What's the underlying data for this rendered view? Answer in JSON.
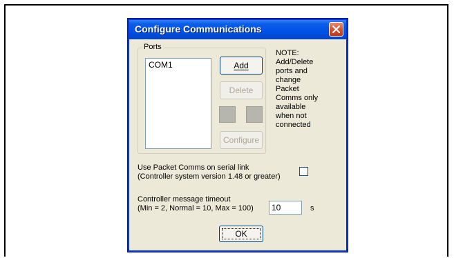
{
  "dialog": {
    "title": "Configure Communications",
    "ports_group_label": "Ports",
    "ports": [
      "COM1"
    ],
    "buttons": {
      "add": "Add",
      "delete": "Delete",
      "configure": "Configure",
      "ok": "OK"
    },
    "note": "NOTE:\nAdd/Delete\nports and\nchange\nPacket\nComms only\navailable\nwhen not\nconnected",
    "packet_comms_label_line1": "Use Packet Comms on serial link",
    "packet_comms_label_line2": "(Controller system version 1.48 or greater)",
    "packet_comms_checked": false,
    "timeout_label_line1": "Controller message timeout",
    "timeout_label_line2": "(Min = 2, Normal = 10, Max = 100)",
    "timeout_value": "10",
    "timeout_unit": "s"
  },
  "icons": {
    "close": "close-icon"
  }
}
